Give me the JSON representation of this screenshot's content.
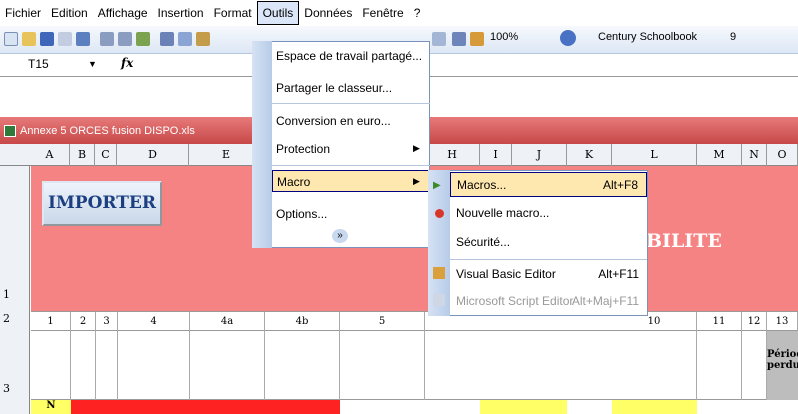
{
  "menubar": {
    "items": [
      "Fichier",
      "Edition",
      "Affichage",
      "Insertion",
      "Format",
      "Outils",
      "Données",
      "Fenêtre",
      "?"
    ]
  },
  "toolbar": {
    "zoom": "100%",
    "font": "Century Schoolbook",
    "size": "9"
  },
  "formula": {
    "cell_ref": "T15",
    "fx_label": "fx"
  },
  "workbook": {
    "title": "Annexe 5 ORCES fusion DISPO.xls"
  },
  "columns": [
    "A",
    "B",
    "C",
    "D",
    "E",
    "H",
    "I",
    "J",
    "K",
    "L",
    "M",
    "N",
    "O"
  ],
  "rows": [
    "1",
    "2",
    "3"
  ],
  "sheet": {
    "import_button": "IMPORTER",
    "heading_fragment": "BILITE",
    "row2_values": [
      "1",
      "2",
      "3",
      "4",
      "4a",
      "4b",
      "5",
      "10",
      "11",
      "12",
      "13"
    ],
    "row3_label_line1": "Périodes",
    "row3_label_line2": "perdues",
    "row4_value": "N"
  },
  "outils_menu": {
    "items": [
      "Espace de travail partagé...",
      "Partager le classeur...",
      "Conversion en euro...",
      "Protection",
      "Macro",
      "Options..."
    ],
    "expand": "»"
  },
  "macro_submenu": {
    "items": [
      {
        "label": "Macros...",
        "shortcut": "Alt+F8"
      },
      {
        "label": "Nouvelle macro...",
        "shortcut": ""
      },
      {
        "label": "Sécurité...",
        "shortcut": ""
      },
      {
        "label": "Visual Basic Editor",
        "shortcut": "Alt+F11"
      },
      {
        "label": "Microsoft Script Editor",
        "shortcut": "Alt+Maj+F11"
      }
    ]
  }
}
